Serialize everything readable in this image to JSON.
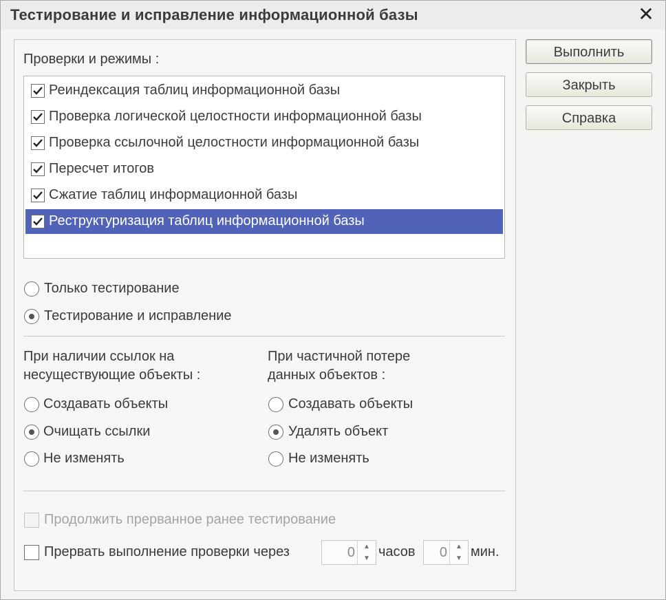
{
  "window": {
    "title": "Тестирование и исправление информационной базы"
  },
  "checks": {
    "label": "Проверки и режимы :",
    "items": [
      {
        "label": "Реиндексация таблиц информационной базы",
        "checked": true
      },
      {
        "label": "Проверка логической целостности информационной базы",
        "checked": true
      },
      {
        "label": "Проверка ссылочной целостности информационной базы",
        "checked": true
      },
      {
        "label": "Пересчет итогов",
        "checked": true
      },
      {
        "label": "Сжатие таблиц информационной базы",
        "checked": true
      },
      {
        "label": "Реструктуризация таблиц информационной базы",
        "checked": true,
        "selected": true
      }
    ]
  },
  "mode": {
    "options": [
      {
        "label": "Только тестирование",
        "selected": false
      },
      {
        "label": "Тестирование и исправление",
        "selected": true
      }
    ]
  },
  "missing_refs": {
    "label_line1": "При наличии ссылок на",
    "label_line2": "несуществующие объекты :",
    "options": [
      {
        "label": "Создавать объекты",
        "selected": false
      },
      {
        "label": "Очищать ссылки",
        "selected": true
      },
      {
        "label": "Не изменять",
        "selected": false
      }
    ]
  },
  "partial_loss": {
    "label_line1": "При частичной потере",
    "label_line2": "данных объектов :",
    "options": [
      {
        "label": "Создавать объекты",
        "selected": false
      },
      {
        "label": "Удалять объект",
        "selected": true
      },
      {
        "label": "Не изменять",
        "selected": false
      }
    ]
  },
  "resume": {
    "label": "Продолжить прерванное ранее тестирование",
    "checked": false,
    "enabled": false
  },
  "interrupt": {
    "label": "Прервать выполнение проверки через",
    "checked": false,
    "hours_value": "0",
    "hours_label": "часов",
    "minutes_value": "0",
    "minutes_label": "мин."
  },
  "buttons": {
    "run": "Выполнить",
    "close": "Закрыть",
    "help": "Справка"
  },
  "icons": {
    "close": "close-icon",
    "check": "checkmark-icon",
    "spin_up": "arrow-up-icon",
    "spin_down": "arrow-down-icon"
  }
}
